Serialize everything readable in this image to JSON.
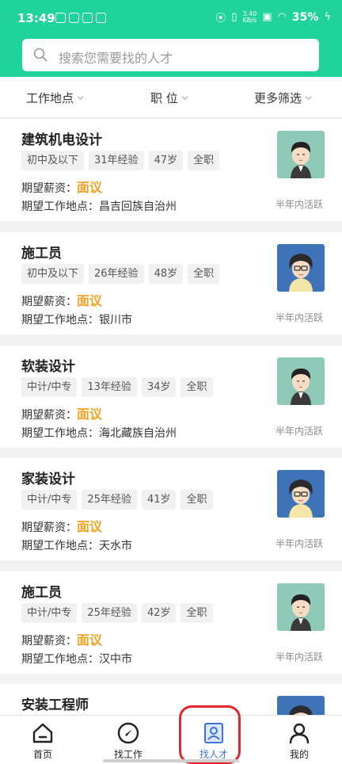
{
  "status_bar": {
    "time": "13:49",
    "speed_value": "3.40",
    "speed_unit": "KB/s",
    "battery": "35%"
  },
  "search": {
    "placeholder": "搜索您需要找的人才"
  },
  "filters": [
    {
      "label": "工作地点"
    },
    {
      "label": "职 位"
    },
    {
      "label": "更多筛选"
    }
  ],
  "salary_label": "期望薪资：",
  "location_label": "期望工作地点：",
  "candidates": [
    {
      "title": "建筑机电设计",
      "tags": [
        "初中及以下",
        "31年经验",
        "47岁",
        "全职"
      ],
      "salary": "面议",
      "location": "昌吉回族自治州",
      "activity": "半年内活跃",
      "avatar": "male-short-hair-avatar",
      "avatar_bg": "#8fc9b7"
    },
    {
      "title": "施工员",
      "tags": [
        "初中及以下",
        "26年经验",
        "48岁",
        "全职"
      ],
      "salary": "面议",
      "location": "银川市",
      "activity": "半年内活跃",
      "avatar": "curly-hair-glasses-avatar",
      "avatar_bg": "#3f73b8"
    },
    {
      "title": "软装设计",
      "tags": [
        "中计/中专",
        "13年经验",
        "34岁",
        "全职"
      ],
      "salary": "面议",
      "location": "海北藏族自治州",
      "activity": "半年内活跃",
      "avatar": "male-short-hair-avatar",
      "avatar_bg": "#8fc9b7"
    },
    {
      "title": "家装设计",
      "tags": [
        "中计/中专",
        "25年经验",
        "41岁",
        "全职"
      ],
      "salary": "面议",
      "location": "天水市",
      "activity": "半年内活跃",
      "avatar": "curly-hair-glasses-avatar",
      "avatar_bg": "#3f73b8"
    },
    {
      "title": "施工员",
      "tags": [
        "中计/中专",
        "25年经验",
        "42岁",
        "全职"
      ],
      "salary": "面议",
      "location": "汉中市",
      "activity": "半年内活跃",
      "avatar": "male-short-hair-avatar",
      "avatar_bg": "#8fc9b7"
    },
    {
      "title": "安装工程师",
      "tags": [],
      "salary": "",
      "location": "",
      "activity": "",
      "avatar": "curly-hair-glasses-avatar",
      "avatar_bg": "#3f73b8"
    }
  ],
  "bottom_nav": [
    {
      "label": "首页",
      "icon": "home-icon"
    },
    {
      "label": "找工作",
      "icon": "compass-icon"
    },
    {
      "label": "找人才",
      "icon": "talent-card-icon",
      "active": true
    },
    {
      "label": "我的",
      "icon": "profile-icon"
    }
  ],
  "colors": {
    "brand_green": "#1fd39a",
    "salary_orange": "#f0a323",
    "nav_active_blue": "#3b73d8",
    "highlight_red": "#e0282e"
  }
}
